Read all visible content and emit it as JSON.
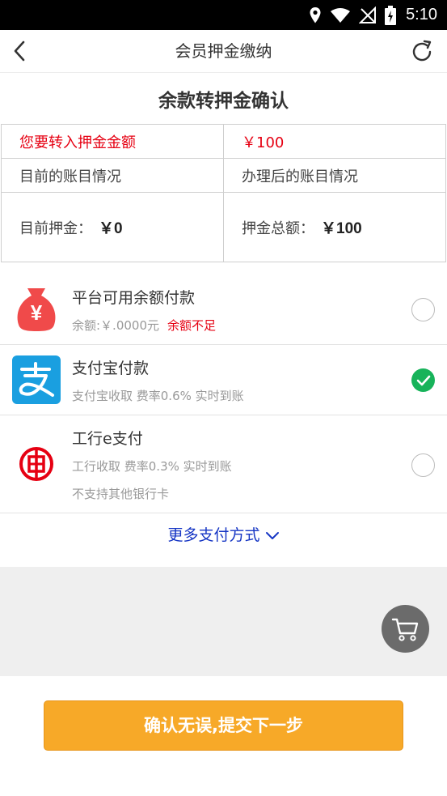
{
  "status_bar": {
    "time": "5:10"
  },
  "header": {
    "title": "会员押金缴纳"
  },
  "section_title": "余款转押金确认",
  "deposit_table": {
    "transfer_label": "您要转入押金金额",
    "transfer_amount": "￥100",
    "current_header": "目前的账目情况",
    "after_header": "办理后的账目情况",
    "current_deposit_label": "目前押金：",
    "current_deposit_value": "￥0",
    "total_deposit_label": "押金总额：",
    "total_deposit_value": "￥100"
  },
  "payment_methods": [
    {
      "name": "平台可用余额付款",
      "desc": "余额:￥.0000元",
      "warning": "余额不足",
      "selected": false,
      "icon": "money-bag-icon"
    },
    {
      "name": "支付宝付款",
      "desc": "支付宝收取 费率0.6% 实时到账",
      "selected": true,
      "icon": "alipay-icon"
    },
    {
      "name": "工行e支付",
      "desc": "工行收取 费率0.3% 实时到账",
      "desc2": "不支持其他银行卡",
      "selected": false,
      "icon": "icbc-icon"
    }
  ],
  "more_payment": "更多支付方式",
  "submit_label": "确认无误,提交下一步",
  "colors": {
    "accent_red": "#e60012",
    "link_blue": "#1535c4",
    "check_green": "#17b35a",
    "submit_orange": "#f7a928",
    "alipay_blue": "#1a9fe0"
  }
}
